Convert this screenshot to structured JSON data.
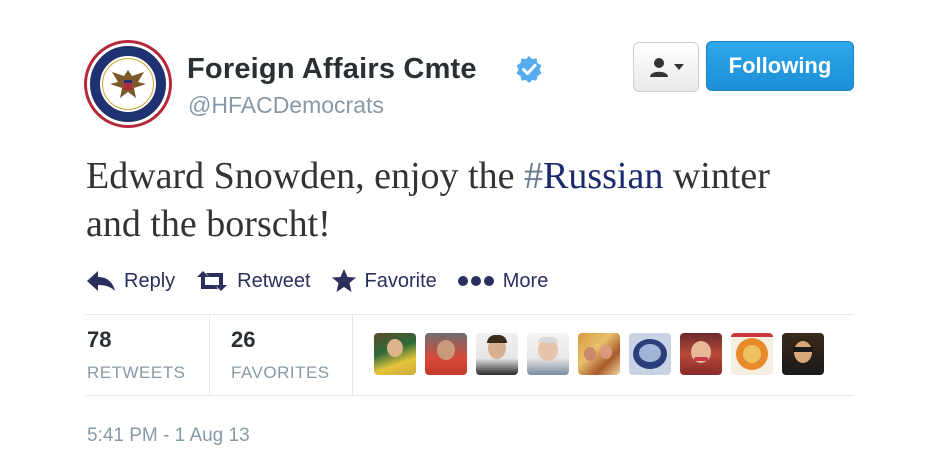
{
  "profile": {
    "name": "Foreign Affairs Cmte",
    "handle": "@HFACDemocrats",
    "avatar_icon": "committee-seal-icon",
    "verified_icon": "verified-badge-icon",
    "verified_color": "#55acee"
  },
  "buttons": {
    "follow_menu_icon": "user-dropdown-icon",
    "following_label": "Following",
    "following_color": "#2fa7e9"
  },
  "tweet": {
    "text_before": "Edward Snowden, enjoy the ",
    "hash_symbol": "#",
    "hashtag": "Russian",
    "text_after": " winter and the borscht!"
  },
  "actions": {
    "reply": "Reply",
    "retweet": "Retweet",
    "favorite": "Favorite",
    "more": "More",
    "color": "#2b2f5e"
  },
  "stats": {
    "retweets_count": "78",
    "retweets_label": "RETWEETS",
    "favorites_count": "26",
    "favorites_label": "FAVORITES"
  },
  "favoriters": [
    {
      "icon": "user-avatar-1"
    },
    {
      "icon": "user-avatar-2"
    },
    {
      "icon": "user-avatar-3"
    },
    {
      "icon": "user-avatar-4"
    },
    {
      "icon": "user-avatar-5"
    },
    {
      "icon": "user-avatar-6"
    },
    {
      "icon": "user-avatar-7"
    },
    {
      "icon": "user-avatar-8"
    },
    {
      "icon": "user-avatar-9"
    }
  ],
  "timestamp": "5:41 PM - 1 Aug 13"
}
